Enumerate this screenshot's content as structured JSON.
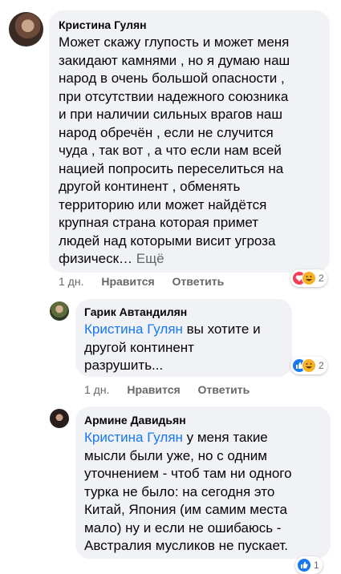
{
  "comments": [
    {
      "author": "Кристина Гулян",
      "lines": [
        "Может скажу глупость и может меня",
        "закидают камнями , но я думаю наш",
        "народ в очень большой опасности ,",
        "при отсутствии надежного союзника",
        "и при наличии сильных врагов наш",
        "народ обречён , если не случится",
        "чуда , так вот , а что если нам всей",
        "нацией попросить переселиться на",
        "другой континент , обменять",
        "территорию или может найдётся",
        "крупная страна которая примет",
        "людей над которыми висит угроза"
      ],
      "last_line": "физическ…",
      "more": "Ещё",
      "time": "1 дн.",
      "like": "Нравится",
      "reply": "Ответить",
      "reaction_icons": [
        "love",
        "haha"
      ],
      "reaction_count": "2"
    },
    {
      "author": "Гарик Автандилян",
      "mention": "Кристина Гулян",
      "lines": [
        " вы хотите и",
        "другой континент",
        "разрушить..."
      ],
      "time": "1 дн.",
      "like": "Нравится",
      "reply": "Ответить",
      "reaction_icons": [
        "like",
        "haha"
      ],
      "reaction_count": "2"
    },
    {
      "author": "Армине Давидьян",
      "mention": "Кристина Гулян",
      "lines": [
        " у меня такие",
        "мысли были уже, но с одним",
        "уточнением - чтоб там ни одного",
        "турка не было: на сегодня это",
        "Китай, Япония (им самим места",
        "мало) ну и если не ошибаюсь -",
        "Австралия мусликов не пускает."
      ],
      "reaction_icons": [
        "like"
      ],
      "reaction_count": "1"
    }
  ],
  "colors": {
    "mention": "#1877f2",
    "bubble": "#f0f2f5",
    "meta": "#65676b",
    "like": "#1877f2",
    "love": "#f33e58",
    "haha": "#f7b125"
  }
}
